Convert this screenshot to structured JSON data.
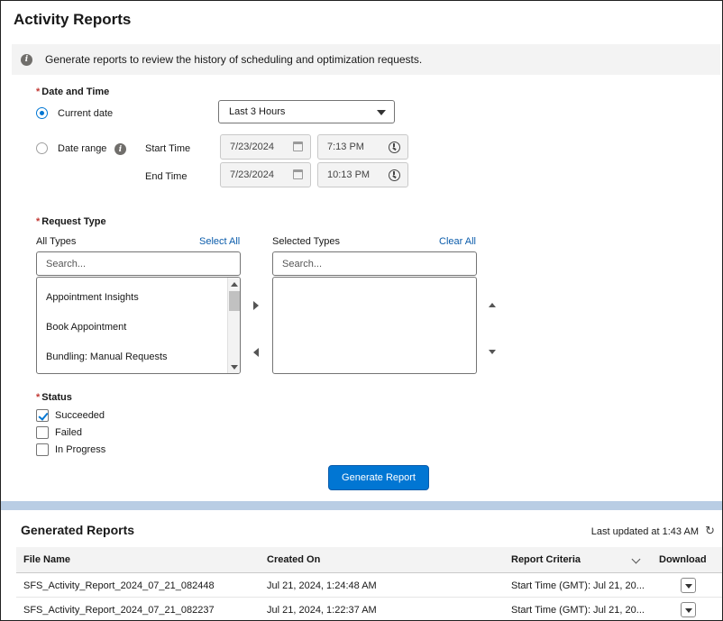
{
  "page": {
    "title": "Activity Reports"
  },
  "info": {
    "text": "Generate reports to review the history of scheduling and optimization requests."
  },
  "date_time": {
    "label": "Date and Time",
    "required_mark": "*",
    "current_date_label": "Current date",
    "current_date_selected": true,
    "range_select_value": "Last 3 Hours",
    "date_range_label": "Date range",
    "start_time_label": "Start Time",
    "end_time_label": "End Time",
    "start_date": "7/23/2024",
    "start_time": "7:13 PM",
    "end_date": "7/23/2024",
    "end_time": "10:13 PM"
  },
  "request_type": {
    "label": "Request Type",
    "required_mark": "*",
    "all_types_label": "All Types",
    "select_all_label": "Select All",
    "selected_types_label": "Selected Types",
    "clear_all_label": "Clear All",
    "all_search_placeholder": "Search...",
    "selected_search_placeholder": "Search...",
    "all_types_items": [
      "Appointment Insights",
      "Book Appointment",
      "Bundling: Manual Requests"
    ]
  },
  "status": {
    "label": "Status",
    "required_mark": "*",
    "options": [
      {
        "label": "Succeeded",
        "checked": true
      },
      {
        "label": "Failed",
        "checked": false
      },
      {
        "label": "In Progress",
        "checked": false
      }
    ]
  },
  "generate_button_label": "Generate Report",
  "generated_reports": {
    "title": "Generated Reports",
    "last_updated": "Last updated at 1:43 AM",
    "refresh_icon": "refresh-icon",
    "columns": [
      "File Name",
      "Created On",
      "Report Criteria",
      "Download"
    ],
    "rows": [
      {
        "file_name": "SFS_Activity_Report_2024_07_21_082448",
        "created_on": "Jul 21, 2024, 1:24:48 AM",
        "criteria": "Start Time (GMT): Jul 21, 20..."
      },
      {
        "file_name": "SFS_Activity_Report_2024_07_21_082237",
        "created_on": "Jul 21, 2024, 1:22:37 AM",
        "criteria": "Start Time (GMT): Jul 21, 20..."
      }
    ]
  },
  "colors": {
    "brand": "#0176d3",
    "link": "#0b5cab",
    "required": "#c23934",
    "band": "#b9cde4"
  }
}
